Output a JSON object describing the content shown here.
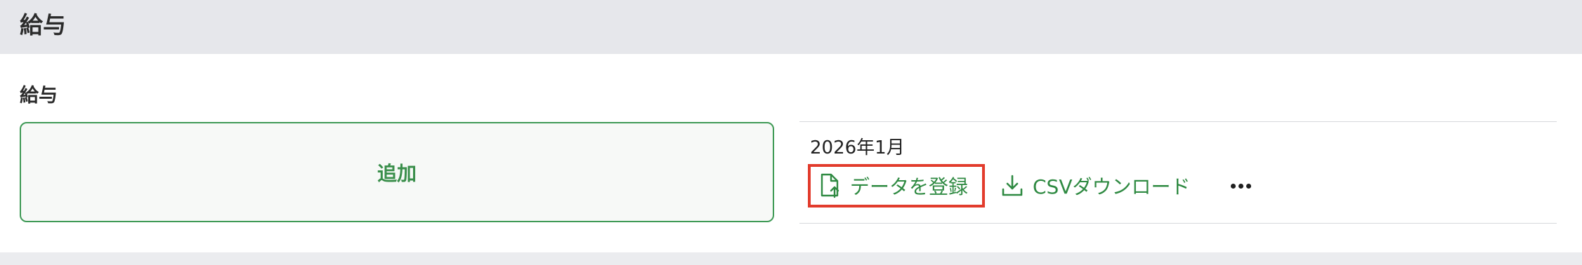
{
  "header": {
    "title": "給与"
  },
  "section": {
    "title": "給与",
    "add_label": "追加"
  },
  "record": {
    "period": "2026年1月",
    "actions": {
      "register_label": "データを登録",
      "csv_download_label": "CSVダウンロード",
      "more_icon": "more-horizontal-icon",
      "register_icon": "file-upload-icon",
      "download_icon": "download-icon"
    }
  },
  "colors": {
    "accent_green": "#3a8f4b",
    "highlight_red": "#e23b2c",
    "header_bg": "#e6e7eb"
  }
}
